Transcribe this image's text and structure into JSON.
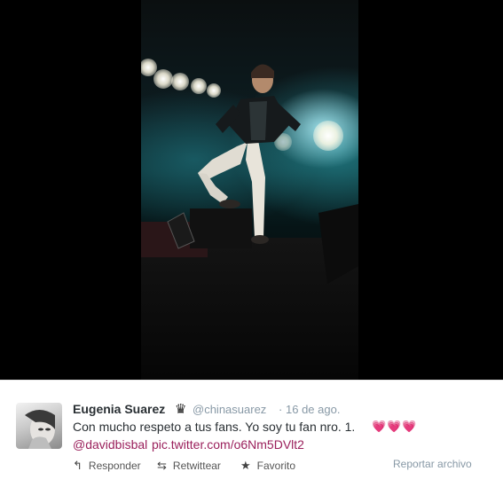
{
  "tweet": {
    "display_name": "Eugenia Suarez",
    "verified_icon": "crown-icon",
    "handle": "@chinasuarez",
    "separator": "·",
    "date": "16 de ago.",
    "text": "Con mucho respeto a tus fans. Yo soy tu fan nro. 1.",
    "emoji": "💗💗💗",
    "mention": "@davidbisbal",
    "link": "pic.twitter.com/o6Nm5DVlt2"
  },
  "actions": {
    "reply_label": "Responder",
    "retweet_label": "Retwittear",
    "favorite_label": "Favorito",
    "report_label": "Reportar archivo"
  },
  "icons": {
    "reply": "reply-icon",
    "retweet": "retweet-icon",
    "favorite": "star-icon"
  },
  "colors": {
    "link": "#9a1f5b",
    "meta": "#8899a6",
    "text": "#292f33"
  }
}
